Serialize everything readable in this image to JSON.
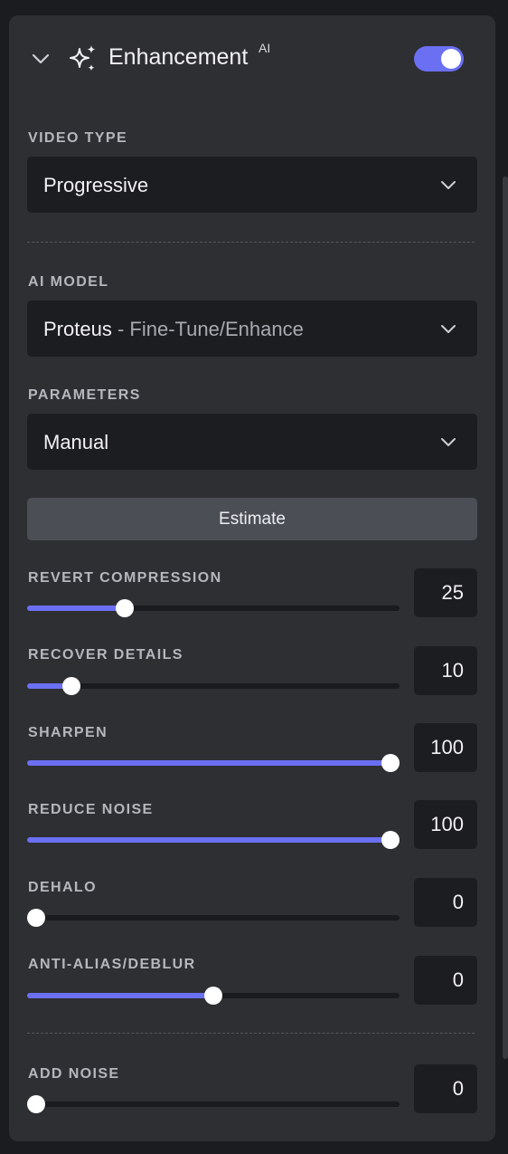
{
  "header": {
    "title": "Enhancement",
    "superscript": "AI",
    "toggle_on": true,
    "accent_color": "#6b70f3"
  },
  "video_type": {
    "label": "VIDEO TYPE",
    "value": "Progressive"
  },
  "ai_model": {
    "label": "AI MODEL",
    "name": "Proteus",
    "separator": "-",
    "variant": "Fine-Tune/Enhance"
  },
  "parameters": {
    "label": "PARAMETERS",
    "value": "Manual"
  },
  "estimate_label": "Estimate",
  "sliders": [
    {
      "label": "REVERT COMPRESSION",
      "value": "25",
      "fraction": 0.263
    },
    {
      "label": "RECOVER DETAILS",
      "value": "10",
      "fraction": 0.119
    },
    {
      "label": "SHARPEN",
      "value": "100",
      "fraction": 0.976
    },
    {
      "label": "REDUCE NOISE",
      "value": "100",
      "fraction": 0.976
    },
    {
      "label": "DEHALO",
      "value": "0",
      "fraction": 0.024
    },
    {
      "label": "ANTI-ALIAS/DEBLUR",
      "value": "0",
      "fraction": 0.5
    },
    {
      "label": "ADD NOISE",
      "value": "0",
      "fraction": 0.024
    }
  ],
  "icons": {
    "collapse": "chevron-down-icon",
    "sparkle": "sparkle-icon",
    "dropdown": "chevron-down-icon"
  }
}
